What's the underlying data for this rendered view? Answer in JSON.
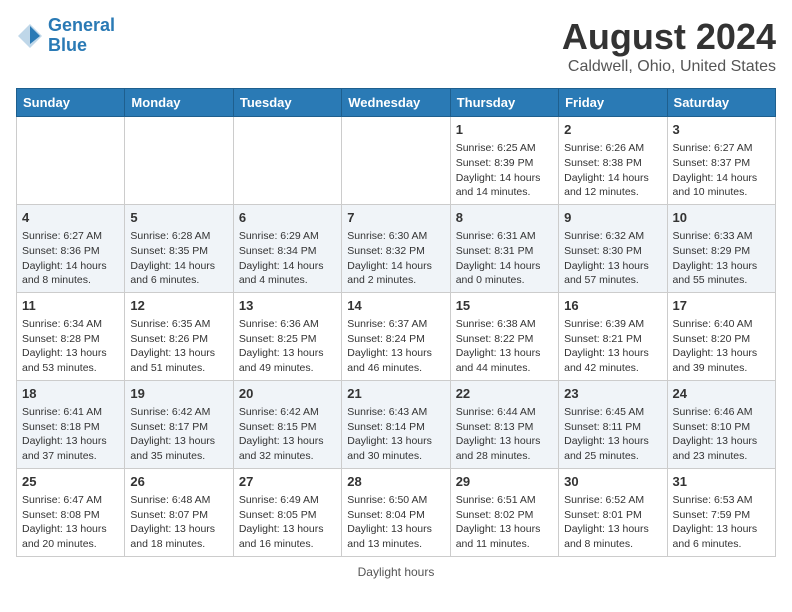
{
  "header": {
    "logo_line1": "General",
    "logo_line2": "Blue",
    "main_title": "August 2024",
    "subtitle": "Caldwell, Ohio, United States"
  },
  "footer": {
    "note": "Daylight hours"
  },
  "days_of_week": [
    "Sunday",
    "Monday",
    "Tuesday",
    "Wednesday",
    "Thursday",
    "Friday",
    "Saturday"
  ],
  "weeks": [
    {
      "days": [
        {
          "num": "",
          "info": ""
        },
        {
          "num": "",
          "info": ""
        },
        {
          "num": "",
          "info": ""
        },
        {
          "num": "",
          "info": ""
        },
        {
          "num": "1",
          "info": "Sunrise: 6:25 AM\nSunset: 8:39 PM\nDaylight: 14 hours\nand 14 minutes."
        },
        {
          "num": "2",
          "info": "Sunrise: 6:26 AM\nSunset: 8:38 PM\nDaylight: 14 hours\nand 12 minutes."
        },
        {
          "num": "3",
          "info": "Sunrise: 6:27 AM\nSunset: 8:37 PM\nDaylight: 14 hours\nand 10 minutes."
        }
      ]
    },
    {
      "days": [
        {
          "num": "4",
          "info": "Sunrise: 6:27 AM\nSunset: 8:36 PM\nDaylight: 14 hours\nand 8 minutes."
        },
        {
          "num": "5",
          "info": "Sunrise: 6:28 AM\nSunset: 8:35 PM\nDaylight: 14 hours\nand 6 minutes."
        },
        {
          "num": "6",
          "info": "Sunrise: 6:29 AM\nSunset: 8:34 PM\nDaylight: 14 hours\nand 4 minutes."
        },
        {
          "num": "7",
          "info": "Sunrise: 6:30 AM\nSunset: 8:32 PM\nDaylight: 14 hours\nand 2 minutes."
        },
        {
          "num": "8",
          "info": "Sunrise: 6:31 AM\nSunset: 8:31 PM\nDaylight: 14 hours\nand 0 minutes."
        },
        {
          "num": "9",
          "info": "Sunrise: 6:32 AM\nSunset: 8:30 PM\nDaylight: 13 hours\nand 57 minutes."
        },
        {
          "num": "10",
          "info": "Sunrise: 6:33 AM\nSunset: 8:29 PM\nDaylight: 13 hours\nand 55 minutes."
        }
      ]
    },
    {
      "days": [
        {
          "num": "11",
          "info": "Sunrise: 6:34 AM\nSunset: 8:28 PM\nDaylight: 13 hours\nand 53 minutes."
        },
        {
          "num": "12",
          "info": "Sunrise: 6:35 AM\nSunset: 8:26 PM\nDaylight: 13 hours\nand 51 minutes."
        },
        {
          "num": "13",
          "info": "Sunrise: 6:36 AM\nSunset: 8:25 PM\nDaylight: 13 hours\nand 49 minutes."
        },
        {
          "num": "14",
          "info": "Sunrise: 6:37 AM\nSunset: 8:24 PM\nDaylight: 13 hours\nand 46 minutes."
        },
        {
          "num": "15",
          "info": "Sunrise: 6:38 AM\nSunset: 8:22 PM\nDaylight: 13 hours\nand 44 minutes."
        },
        {
          "num": "16",
          "info": "Sunrise: 6:39 AM\nSunset: 8:21 PM\nDaylight: 13 hours\nand 42 minutes."
        },
        {
          "num": "17",
          "info": "Sunrise: 6:40 AM\nSunset: 8:20 PM\nDaylight: 13 hours\nand 39 minutes."
        }
      ]
    },
    {
      "days": [
        {
          "num": "18",
          "info": "Sunrise: 6:41 AM\nSunset: 8:18 PM\nDaylight: 13 hours\nand 37 minutes."
        },
        {
          "num": "19",
          "info": "Sunrise: 6:42 AM\nSunset: 8:17 PM\nDaylight: 13 hours\nand 35 minutes."
        },
        {
          "num": "20",
          "info": "Sunrise: 6:42 AM\nSunset: 8:15 PM\nDaylight: 13 hours\nand 32 minutes."
        },
        {
          "num": "21",
          "info": "Sunrise: 6:43 AM\nSunset: 8:14 PM\nDaylight: 13 hours\nand 30 minutes."
        },
        {
          "num": "22",
          "info": "Sunrise: 6:44 AM\nSunset: 8:13 PM\nDaylight: 13 hours\nand 28 minutes."
        },
        {
          "num": "23",
          "info": "Sunrise: 6:45 AM\nSunset: 8:11 PM\nDaylight: 13 hours\nand 25 minutes."
        },
        {
          "num": "24",
          "info": "Sunrise: 6:46 AM\nSunset: 8:10 PM\nDaylight: 13 hours\nand 23 minutes."
        }
      ]
    },
    {
      "days": [
        {
          "num": "25",
          "info": "Sunrise: 6:47 AM\nSunset: 8:08 PM\nDaylight: 13 hours\nand 20 minutes."
        },
        {
          "num": "26",
          "info": "Sunrise: 6:48 AM\nSunset: 8:07 PM\nDaylight: 13 hours\nand 18 minutes."
        },
        {
          "num": "27",
          "info": "Sunrise: 6:49 AM\nSunset: 8:05 PM\nDaylight: 13 hours\nand 16 minutes."
        },
        {
          "num": "28",
          "info": "Sunrise: 6:50 AM\nSunset: 8:04 PM\nDaylight: 13 hours\nand 13 minutes."
        },
        {
          "num": "29",
          "info": "Sunrise: 6:51 AM\nSunset: 8:02 PM\nDaylight: 13 hours\nand 11 minutes."
        },
        {
          "num": "30",
          "info": "Sunrise: 6:52 AM\nSunset: 8:01 PM\nDaylight: 13 hours\nand 8 minutes."
        },
        {
          "num": "31",
          "info": "Sunrise: 6:53 AM\nSunset: 7:59 PM\nDaylight: 13 hours\nand 6 minutes."
        }
      ]
    }
  ]
}
